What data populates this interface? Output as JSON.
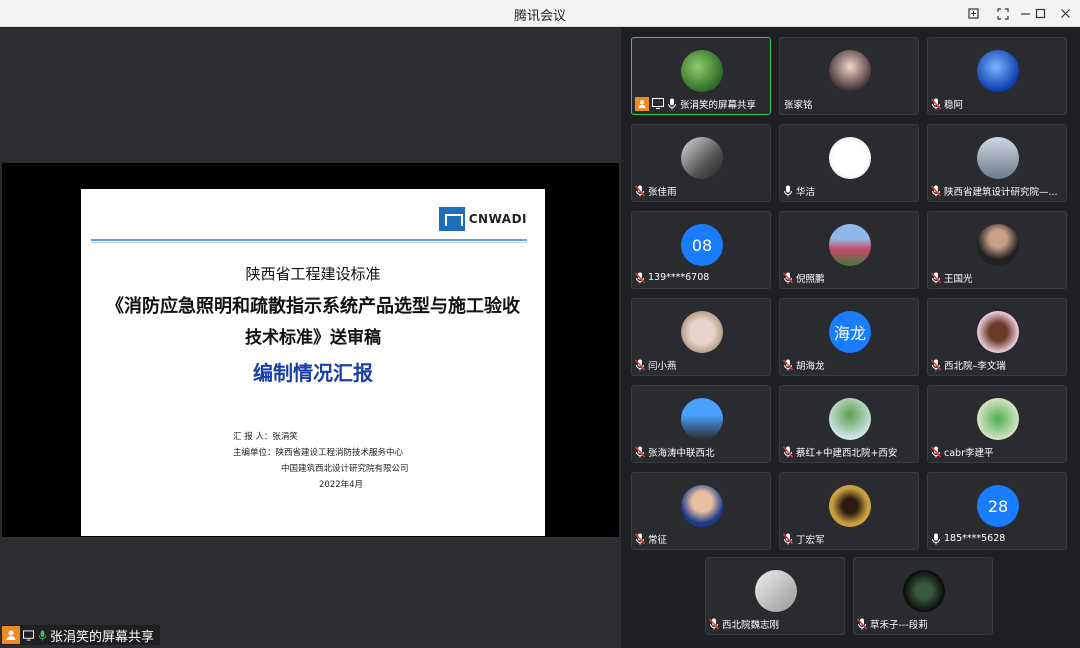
{
  "window": {
    "title": "腾讯会议"
  },
  "slide": {
    "logo_text": "CNWADI",
    "subtitle": "陕西省工程建设标准",
    "title_line1": "《消防应急照明和疏散指示系统产品选型与施工验收",
    "title_line2": "技术标准》送审稿",
    "report_title": "编制情况汇报",
    "reporter": "汇 报 人：张涓笑",
    "editor_line1": "主编单位：陕西省建设工程消防技术服务中心",
    "editor_line2": "中国建筑西北设计研究院有限公司",
    "date": "2022年4月"
  },
  "share_footer": {
    "label": "张涓笑的屏幕共享"
  },
  "participants": [
    {
      "name": "张涓笑的屏幕共享",
      "muted": false,
      "host": true,
      "active": true,
      "avatar": "plant"
    },
    {
      "name": "张家铭",
      "muted": null,
      "avatar": "anime"
    },
    {
      "name": "稳阿",
      "muted": true,
      "avatar": "blue-planet"
    },
    {
      "name": "张佳雨",
      "muted": true,
      "avatar": "bw-photo"
    },
    {
      "name": "华洁",
      "muted": false,
      "avatar": "panda"
    },
    {
      "name": "陕西省建筑设计研究院—...",
      "muted": true,
      "avatar": "building"
    },
    {
      "name": "139****6708",
      "muted": true,
      "avatar_text": "08"
    },
    {
      "name": "倪照鹏",
      "muted": true,
      "avatar": "landscape"
    },
    {
      "name": "王国光",
      "muted": true,
      "avatar": "man-suit"
    },
    {
      "name": "闫小燕",
      "muted": true,
      "avatar": "frame"
    },
    {
      "name": "胡海龙",
      "muted": true,
      "avatar_text": "海龙"
    },
    {
      "name": "西北院–李文瑞",
      "muted": true,
      "avatar": "horse"
    },
    {
      "name": "张海涛中联西北",
      "muted": true,
      "avatar": "couple"
    },
    {
      "name": "蔡红+中建西北院+西安",
      "muted": true,
      "avatar": "tree"
    },
    {
      "name": "cabr李建平",
      "muted": true,
      "avatar": "fern"
    },
    {
      "name": "常征",
      "muted": true,
      "avatar": "man-portrait"
    },
    {
      "name": "丁宏军",
      "muted": true,
      "avatar": "arch"
    },
    {
      "name": "185****5628",
      "muted": false,
      "avatar_text": "28"
    },
    {
      "name": "西北院魏志刚",
      "muted": true,
      "avatar": "drawing"
    },
    {
      "name": "草禾子---段莉",
      "muted": true,
      "avatar": "statue"
    }
  ],
  "colors": {
    "accent_green": "#2fc864",
    "host_orange": "#ef8a24",
    "avatar_blue": "#1a7cff",
    "mic_red": "#e03a3a"
  }
}
